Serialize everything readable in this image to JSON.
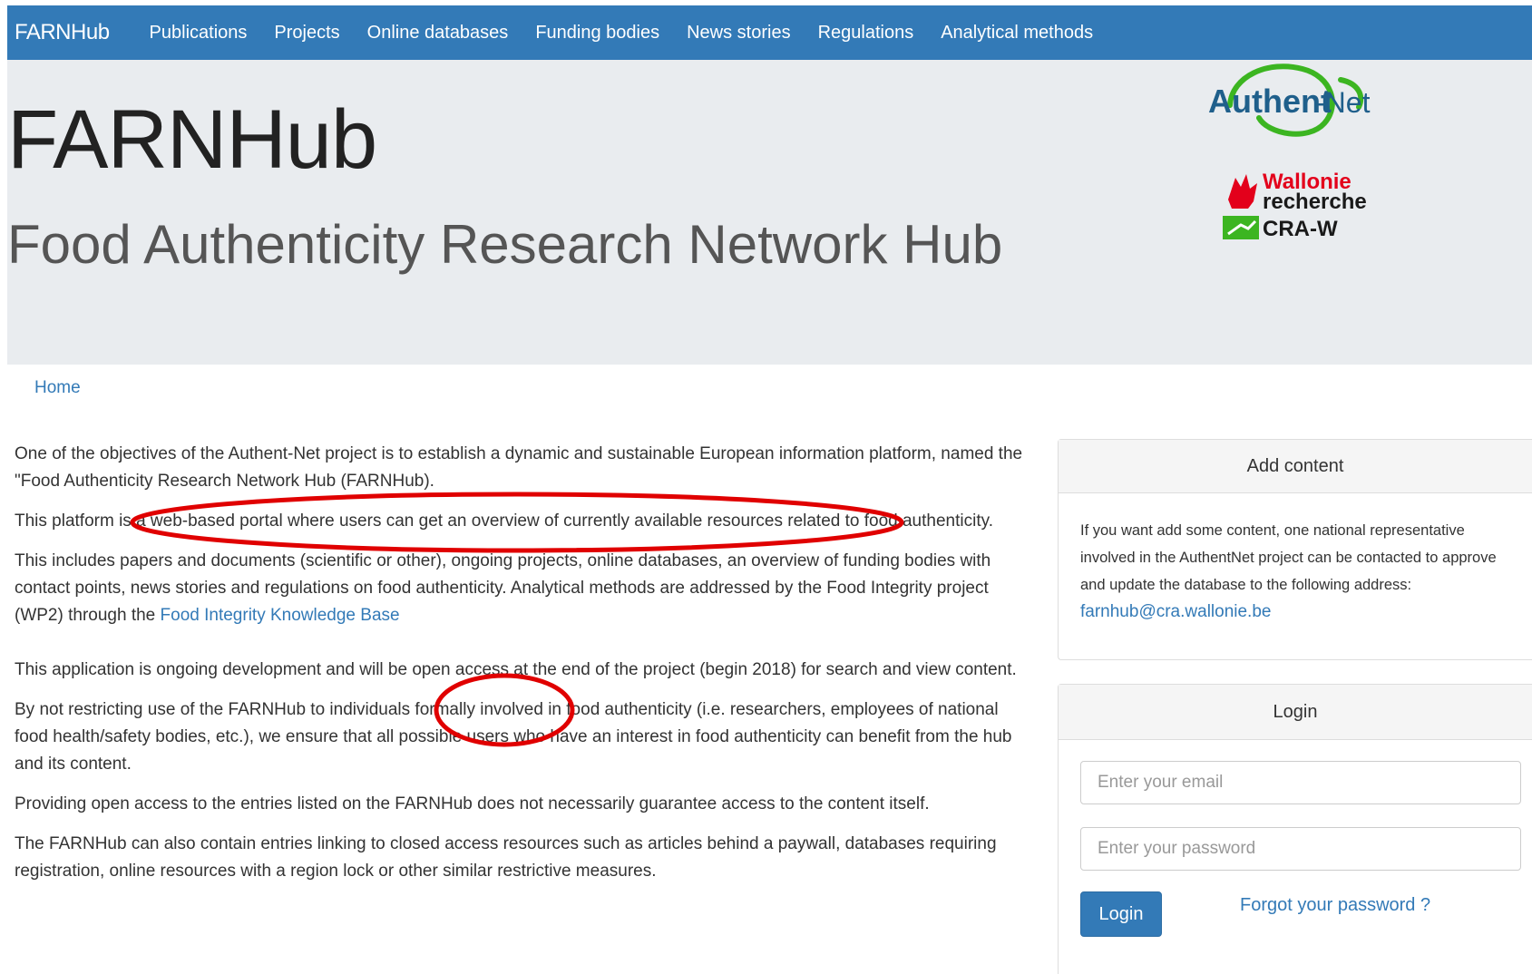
{
  "navbar": {
    "brand": "FARNHub",
    "items": [
      {
        "label": "Publications"
      },
      {
        "label": "Projects"
      },
      {
        "label": "Online databases"
      },
      {
        "label": "Funding bodies"
      },
      {
        "label": "News stories"
      },
      {
        "label": "Regulations"
      },
      {
        "label": "Analytical methods"
      }
    ]
  },
  "jumbotron": {
    "title": "FARNHub",
    "subtitle": "Food Authenticity Research Network Hub"
  },
  "logos": {
    "authent_net": {
      "part1": "Authent",
      "part2": "-Net"
    },
    "wallonie": {
      "line1": "Wallonie",
      "line2": "recherche",
      "line3": "CRA-W"
    }
  },
  "breadcrumb": {
    "home": "Home"
  },
  "content": {
    "p1": "One of the objectives of the Authent-Net project is to establish a dynamic and sustainable European information platform, named the \"Food Authenticity Research Network Hub (FARNHub).",
    "p2": "This platform is a web-based portal where users can get an overview of currently available resources related to food authenticity.",
    "p3_text": "This includes papers and documents (scientific or other), ongoing projects, online databases, an overview of funding bodies with contact points, news stories and regulations on food authenticity. Analytical methods are addressed by the Food Integrity project (WP2) through the ",
    "p3_link": "Food Integrity Knowledge Base",
    "p4": "This application is ongoing development and will be open access at the end of the project (begin 2018) for search and view content.",
    "p5": "By not restricting use of the FARNHub to individuals formally involved in food authenticity (i.e. researchers, employees of national food health/safety bodies, etc.), we ensure that all possible users who have an interest in food authenticity can benefit from the hub and its content.",
    "p6": "Providing open access to the entries listed on the FARNHub does not necessarily guarantee access to the content itself.",
    "p7": "The FARNHub can also contain entries linking to closed access resources such as articles behind a paywall, databases requiring registration, online resources with a region lock or other similar restrictive measures."
  },
  "add_content": {
    "heading": "Add content",
    "body": "If you want add some content, one national representative involved in the AuthentNet project can be contacted to approve and update the database to the following address:",
    "email": "farnhub@cra.wallonie.be"
  },
  "login": {
    "heading": "Login",
    "email_placeholder": "Enter your email",
    "password_placeholder": "Enter your password",
    "button": "Login",
    "forgot": "Forgot your password ?"
  },
  "colors": {
    "primary": "#337ab7",
    "jumbotron_bg": "#e9ecef",
    "annotation": "#e00000",
    "authent_green": "#3cb521",
    "wallonie_red": "#e3001b"
  }
}
